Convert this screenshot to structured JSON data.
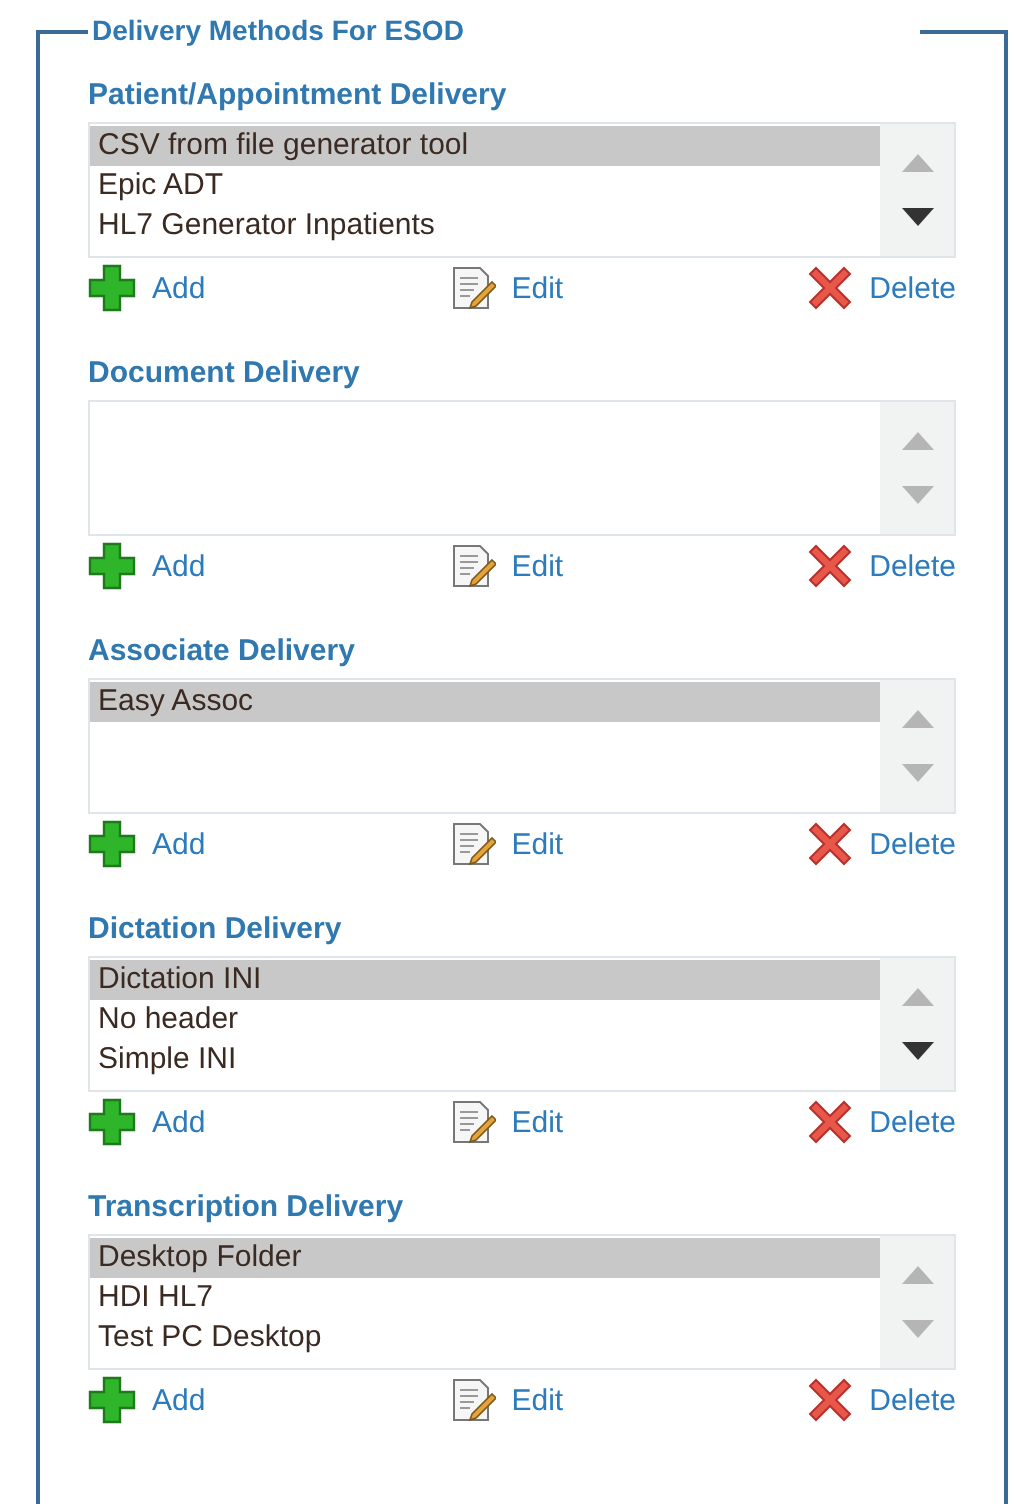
{
  "panel": {
    "title": "Delivery Methods For ESOD"
  },
  "sections": [
    {
      "title": "Patient/Appointment Delivery",
      "more_below": true,
      "items": [
        {
          "label": "CSV from file generator tool",
          "selected": true
        },
        {
          "label": "Epic ADT",
          "selected": false
        },
        {
          "label": "HL7 Generator Inpatients",
          "selected": false
        }
      ],
      "actions": [
        "Add",
        "Edit",
        "Delete"
      ]
    },
    {
      "title": "Document Delivery",
      "more_below": false,
      "actions": [
        "Add",
        "Edit",
        "Delete"
      ]
    },
    {
      "title": "Associate Delivery",
      "more_below": false,
      "items": [
        {
          "label": "Easy Assoc",
          "selected": true
        }
      ],
      "actions": [
        "Add",
        "Edit",
        "Delete"
      ]
    },
    {
      "title": "Dictation Delivery",
      "more_below": true,
      "items": [
        {
          "label": "Dictation INI",
          "selected": true
        },
        {
          "label": "No header",
          "selected": false
        },
        {
          "label": "Simple INI",
          "selected": false
        }
      ],
      "actions": [
        "Add",
        "Edit",
        "Delete"
      ]
    },
    {
      "title": "Transcription Delivery",
      "more_below": false,
      "items": [
        {
          "label": "Desktop Folder",
          "selected": true
        },
        {
          "label": "HDI HL7",
          "selected": false
        },
        {
          "label": "Test PC Desktop",
          "selected": false
        }
      ],
      "actions": [
        "Add",
        "Edit",
        "Delete"
      ]
    }
  ]
}
